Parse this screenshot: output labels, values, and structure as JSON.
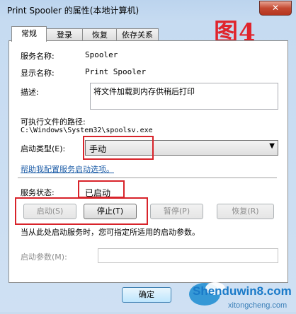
{
  "window": {
    "title": "Print Spooler 的属性(本地计算机)",
    "close": "✕"
  },
  "figure_label": "图4",
  "tabs": [
    "常规",
    "登录",
    "恢复",
    "依存关系"
  ],
  "general": {
    "service_name_label": "服务名称:",
    "service_name_value": "Spooler",
    "display_name_label": "显示名称:",
    "display_name_value": "Print Spooler",
    "description_label": "描述:",
    "description_value": "将文件加载到内存供稍后打印",
    "exe_path_label": "可执行文件的路径:",
    "exe_path_value": "C:\\Windows\\System32\\spoolsv.exe",
    "startup_type_label": "启动类型(E):",
    "startup_type_value": "手动",
    "help_link": "帮助我配置服务启动选项。",
    "status_label": "服务状态:",
    "status_value": "已启动",
    "start_button": "启动(S)",
    "stop_button": "停止(T)",
    "pause_button": "暂停(P)",
    "resume_button": "恢复(R)",
    "hint_text": "当从此处启动服务时，您可指定所适用的启动参数。",
    "start_params_label": "启动参数(M):"
  },
  "footer": {
    "ok_button": "确定"
  },
  "watermark": {
    "line1": "Shenduwin8.com",
    "line2": "xitongcheng.com"
  },
  "colors": {
    "annotation_red": "#d8232a",
    "link_blue": "#1f5ea8"
  }
}
